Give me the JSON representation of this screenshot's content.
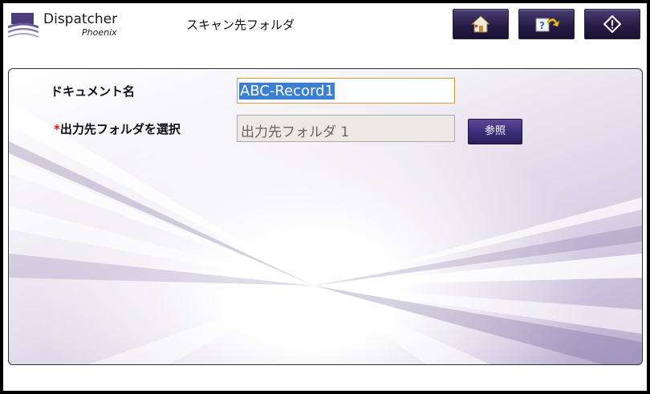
{
  "app": {
    "logo_name": "Dispatcher",
    "logo_sub": "Phoenix"
  },
  "header": {
    "title": "スキャン先フォルダ",
    "buttons": [
      {
        "icon": "home-icon"
      },
      {
        "icon": "help-icon"
      },
      {
        "icon": "start-icon"
      }
    ]
  },
  "form": {
    "document_label": "ドキュメント名",
    "document_value": "ABC-Record1",
    "required_marker": "*",
    "folder_label": "出力先フォルダを選択",
    "folder_value": "出力先フォルダ 1",
    "browse_label": "参照"
  },
  "colors": {
    "accent": "#2a1f5c",
    "required": "#e01010",
    "selection": "#3b7fd4"
  }
}
